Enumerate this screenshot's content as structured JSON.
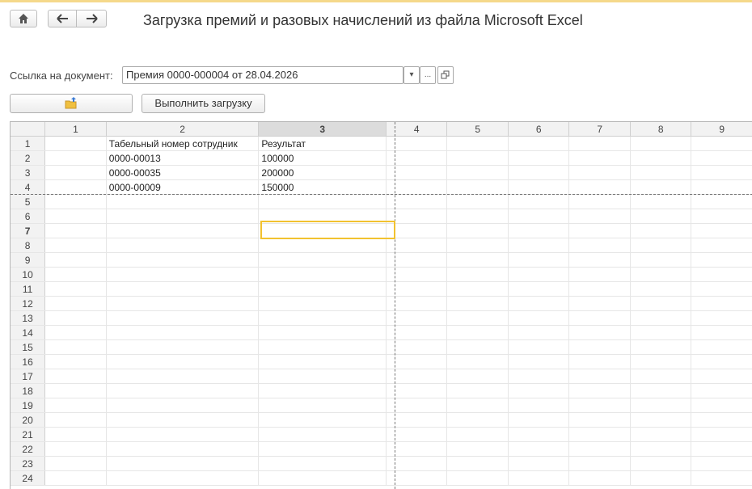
{
  "header": {
    "title": "Загрузка премий и разовых начислений из файла Microsoft Excel"
  },
  "form": {
    "doc_label": "Ссылка на документ:",
    "doc_value": "Премия 0000-000004 от 28.04.2026",
    "dropdown_glyph": "▾",
    "ellipsis_glyph": "...",
    "upload_label": "Выполнить загрузку"
  },
  "sheet": {
    "columns": [
      "",
      "1",
      "2",
      "3",
      "4",
      "5",
      "6",
      "7",
      "8",
      "9"
    ],
    "selected_column": "3",
    "selected_row": "7",
    "rows": [
      {
        "n": "1",
        "c2": "Табельный номер сотрудник",
        "c3": "Результат"
      },
      {
        "n": "2",
        "c2": "0000-00013",
        "c3": "100000"
      },
      {
        "n": "3",
        "c2": "0000-00035",
        "c3": "200000"
      },
      {
        "n": "4",
        "c2": "0000-00009",
        "c3": "150000"
      },
      {
        "n": "5",
        "c2": "",
        "c3": ""
      },
      {
        "n": "6",
        "c2": "",
        "c3": ""
      },
      {
        "n": "7",
        "c2": "",
        "c3": ""
      },
      {
        "n": "8",
        "c2": "",
        "c3": ""
      },
      {
        "n": "9",
        "c2": "",
        "c3": ""
      },
      {
        "n": "10",
        "c2": "",
        "c3": ""
      },
      {
        "n": "11",
        "c2": "",
        "c3": ""
      },
      {
        "n": "12",
        "c2": "",
        "c3": ""
      },
      {
        "n": "13",
        "c2": "",
        "c3": ""
      },
      {
        "n": "14",
        "c2": "",
        "c3": ""
      },
      {
        "n": "15",
        "c2": "",
        "c3": ""
      },
      {
        "n": "16",
        "c2": "",
        "c3": ""
      },
      {
        "n": "17",
        "c2": "",
        "c3": ""
      },
      {
        "n": "18",
        "c2": "",
        "c3": ""
      },
      {
        "n": "19",
        "c2": "",
        "c3": ""
      },
      {
        "n": "20",
        "c2": "",
        "c3": ""
      },
      {
        "n": "21",
        "c2": "",
        "c3": ""
      },
      {
        "n": "22",
        "c2": "",
        "c3": ""
      },
      {
        "n": "23",
        "c2": "",
        "c3": ""
      },
      {
        "n": "24",
        "c2": "",
        "c3": ""
      }
    ]
  },
  "colors": {
    "accent": "#f2c230",
    "top_line": "#f5d98b"
  }
}
